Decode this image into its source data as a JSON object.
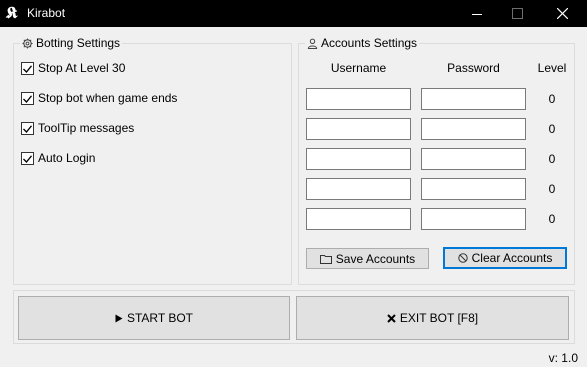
{
  "window": {
    "title": "Kirabot",
    "icon_glyph": "𝕶",
    "icon_name": "kirabot-logo-icon"
  },
  "titlebar_buttons": [
    "minimize",
    "maximize",
    "close"
  ],
  "botting": {
    "title": "Botting Settings",
    "icon": "gear-icon",
    "options": [
      {
        "label": "Stop At Level 30",
        "checked": true
      },
      {
        "label": "Stop bot when game ends",
        "checked": true
      },
      {
        "label": "ToolTip messages",
        "checked": true
      },
      {
        "label": "Auto Login",
        "checked": true
      }
    ]
  },
  "accounts": {
    "title": "Accounts Settings",
    "icon": "user-icon",
    "columns": {
      "username": "Username",
      "password": "Password",
      "level": "Level"
    },
    "rows": [
      {
        "username": "",
        "password": "",
        "level": "0"
      },
      {
        "username": "",
        "password": "",
        "level": "0"
      },
      {
        "username": "",
        "password": "",
        "level": "0"
      },
      {
        "username": "",
        "password": "",
        "level": "0"
      },
      {
        "username": "",
        "password": "",
        "level": "0"
      }
    ],
    "save_label": "Save Accounts",
    "clear_label": "Clear Accounts"
  },
  "actions": {
    "start_label": "START BOT",
    "exit_label": "EXIT BOT [F8]"
  },
  "version": "v: 1.0",
  "colors": {
    "titlebar": "#000000",
    "focus": "#0078d7",
    "background": "#f0f0f0"
  }
}
